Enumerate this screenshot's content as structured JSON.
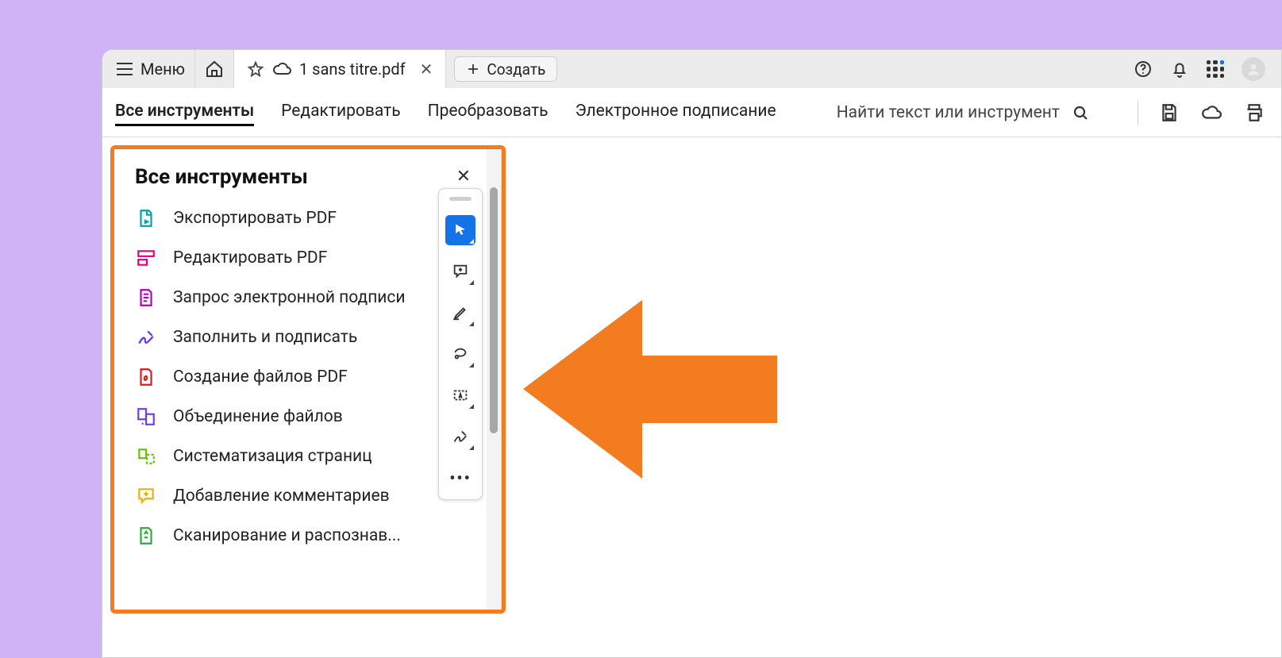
{
  "titlebar": {
    "menu_label": "Меню",
    "tab_title": "1 sans titre.pdf",
    "create_label": "Создать"
  },
  "navbar": {
    "all_tools": "Все инструменты",
    "edit": "Редактировать",
    "convert": "Преобразовать",
    "esign": "Электронное подписание",
    "search_placeholder": "Найти текст или инструмент"
  },
  "sidebar": {
    "title": "Все инструменты",
    "items": [
      "Экспортировать PDF",
      "Редактировать PDF",
      "Запрос электронной подписи",
      "Заполнить и подписать",
      "Создание файлов PDF",
      "Объединение файлов",
      "Систематизация страниц",
      "Добавление комментариев",
      "Сканирование и распознав..."
    ]
  }
}
